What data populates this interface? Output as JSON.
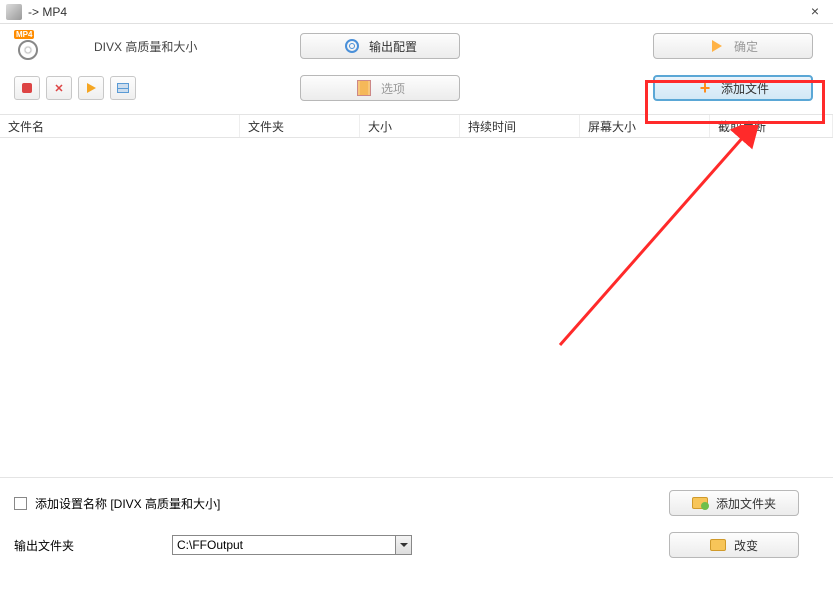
{
  "window": {
    "title": " -> MP4",
    "close_label": "×"
  },
  "format_badge": "MP4",
  "profile_label": "DIVX 高质量和大小",
  "buttons": {
    "output_config": "输出配置",
    "ok": "确定",
    "options": "选项",
    "add_file": "添加文件",
    "add_folder": "添加文件夹",
    "change": "改变"
  },
  "columns": {
    "filename": "文件名",
    "folder": "文件夹",
    "size": "大小",
    "duration": "持续时间",
    "screen_size": "屏幕大小",
    "clip": "截取片断"
  },
  "bottom": {
    "add_setting_label": "添加设置名称 [DIVX 高质量和大小]",
    "output_folder_label": "输出文件夹",
    "output_folder_value": "C:\\FFOutput"
  }
}
